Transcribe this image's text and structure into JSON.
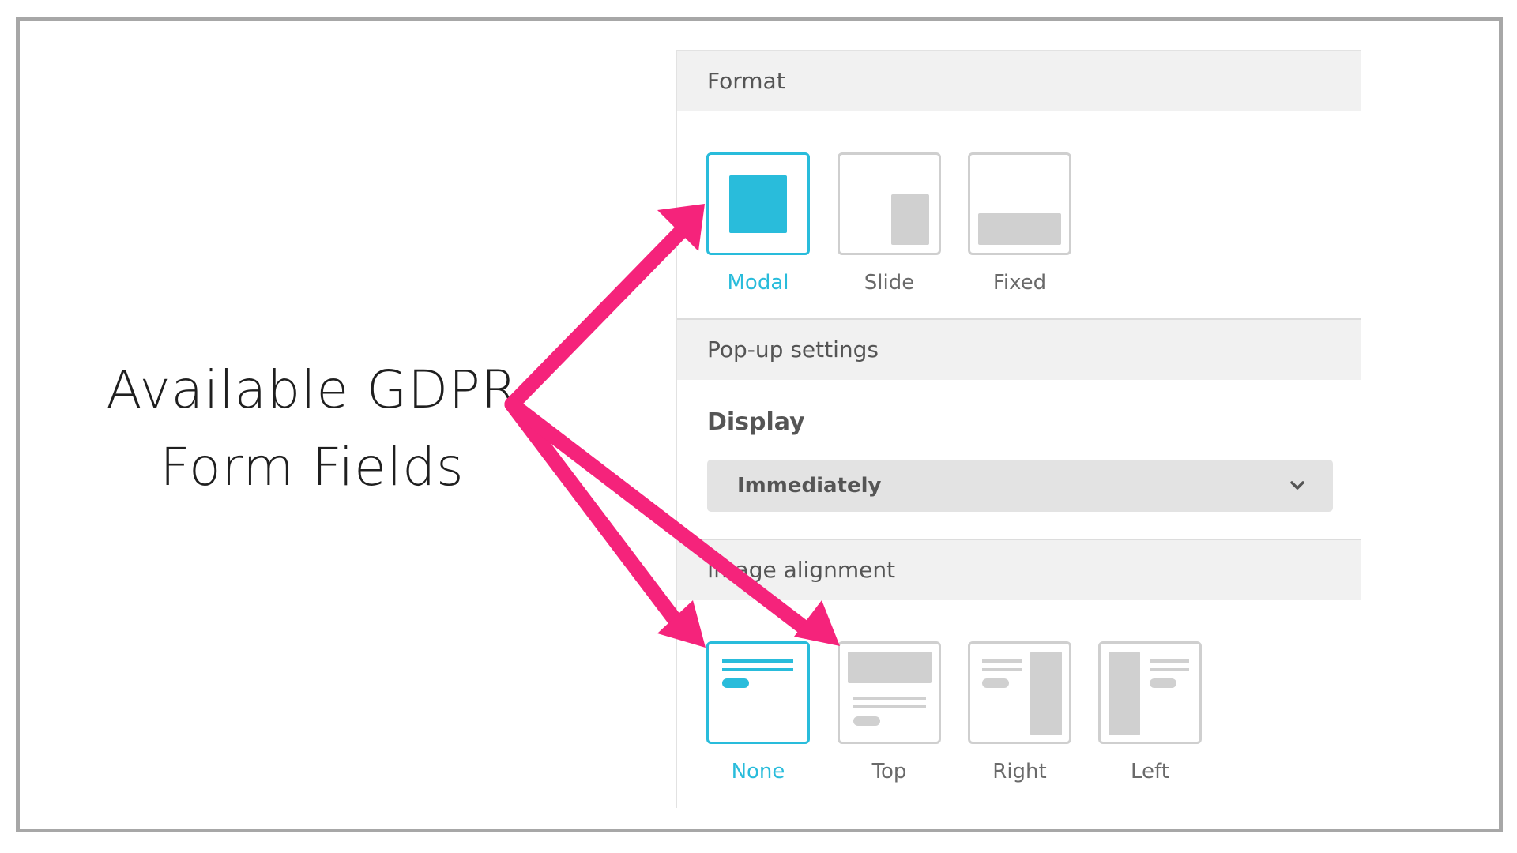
{
  "annotation": {
    "line1": "Available GDPR",
    "line2": "Form Fields"
  },
  "panel": {
    "format": {
      "header": "Format",
      "options": [
        {
          "label": "Modal",
          "icon": "modal-layout-icon",
          "selected": true
        },
        {
          "label": "Slide",
          "icon": "slide-layout-icon",
          "selected": false
        },
        {
          "label": "Fixed",
          "icon": "fixed-layout-icon",
          "selected": false
        }
      ]
    },
    "popup": {
      "header": "Pop-up settings",
      "display_label": "Display",
      "display_value": "Immediately"
    },
    "image_alignment": {
      "header": "Image alignment",
      "options": [
        {
          "label": "None",
          "icon": "align-none-icon",
          "selected": true
        },
        {
          "label": "Top",
          "icon": "align-top-icon",
          "selected": false
        },
        {
          "label": "Right",
          "icon": "align-right-icon",
          "selected": false
        },
        {
          "label": "Left",
          "icon": "align-left-icon",
          "selected": false
        }
      ]
    }
  },
  "colors": {
    "accent": "#29bcdb",
    "arrow": "#f5237b",
    "header_bg": "#f1f1f1",
    "tile_border": "#cfcfcf",
    "placeholder": "#d0d0d0",
    "frame": "#a7a7a7"
  }
}
